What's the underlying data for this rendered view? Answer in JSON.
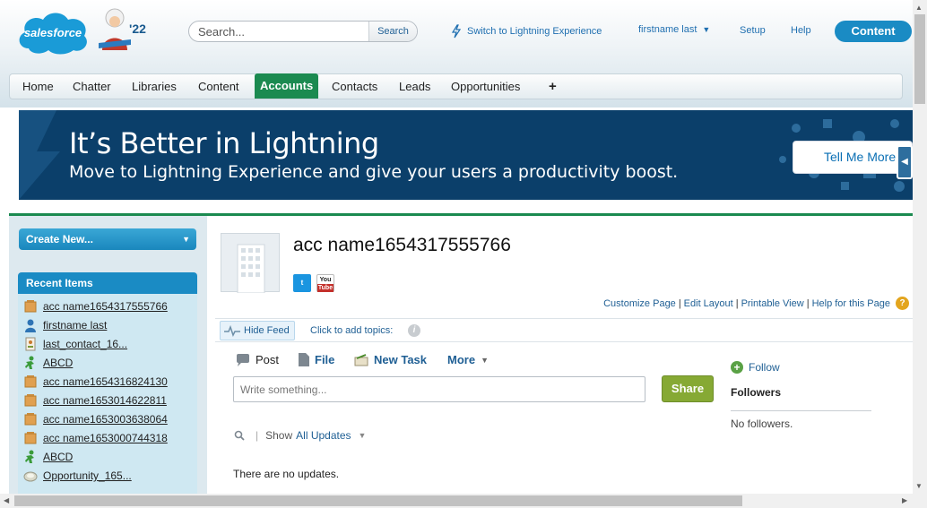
{
  "header": {
    "logo_text": "salesforce",
    "release_badge": "'22",
    "search_placeholder": "Search...",
    "search_button": "Search",
    "switch_lightning": "Switch to Lightning Experience",
    "user_name": "firstname last",
    "setup": "Setup",
    "help": "Help",
    "app_menu": "Content"
  },
  "tabs": [
    "Home",
    "Chatter",
    "Libraries",
    "Content",
    "Accounts",
    "Contacts",
    "Leads",
    "Opportunities",
    "+"
  ],
  "active_tab": "Accounts",
  "banner": {
    "title": "It’s Better in Lightning",
    "subtitle": "Move to Lightning Experience and give your users a productivity boost.",
    "button": "Tell Me More"
  },
  "sidebar": {
    "create_new": "Create New...",
    "recent_items_title": "Recent Items",
    "recent_items": [
      {
        "label": "acc name1654317555766",
        "icon": "account-icon"
      },
      {
        "label": "firstname last",
        "icon": "user-icon"
      },
      {
        "label": "last_contact_16...",
        "icon": "contact-icon"
      },
      {
        "label": "ABCD",
        "icon": "campaign-icon"
      },
      {
        "label": "acc name1654316824130",
        "icon": "account-icon"
      },
      {
        "label": "acc name1653014622811",
        "icon": "account-icon"
      },
      {
        "label": "acc name1653003638064",
        "icon": "account-icon"
      },
      {
        "label": "acc name1653000744318",
        "icon": "account-icon"
      },
      {
        "label": "ABCD",
        "icon": "campaign-icon"
      },
      {
        "label": "Opportunity_165...",
        "icon": "opportunity-icon"
      }
    ]
  },
  "record": {
    "name": "acc name1654317555766",
    "social": {
      "twitter": "t",
      "youtube_top": "You",
      "youtube_bottom": "Tube"
    },
    "page_links": [
      "Customize Page",
      "Edit Layout",
      "Printable View",
      "Help for this Page"
    ],
    "help_glyph": "?"
  },
  "feed": {
    "hide_feed": "Hide Feed",
    "add_topics": "Click to add topics:",
    "info_glyph": "i",
    "publisher_tabs": [
      "Post",
      "File",
      "New Task",
      "More"
    ],
    "write_placeholder": "Write something...",
    "share": "Share",
    "show_label": "Show",
    "filter": "All Updates",
    "no_updates": "There are no updates."
  },
  "followers": {
    "follow": "Follow",
    "follow_glyph": "+",
    "title": "Followers",
    "empty": "No followers."
  },
  "colors": {
    "brand_blue": "#1a8bc4",
    "active_tab_green": "#1b8a50",
    "banner_navy": "#0b3f6a",
    "share_green": "#86a934"
  }
}
